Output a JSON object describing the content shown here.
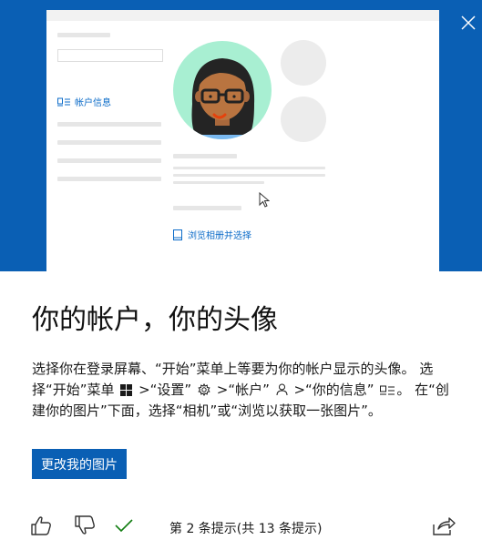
{
  "hero": {
    "side_link_label": "帐户信息",
    "browse_link_label": "浏览相册并选择",
    "accent_color": "#0a5fb4",
    "avatar_ring_color": "#a8efd2"
  },
  "tip": {
    "title": "你的帐户，你的头像",
    "desc": {
      "p1": "选择你在登录屏幕、“开始”菜单上等要为你的帐户显示的头像。 选择“开始”菜单",
      "p2": " >“设置”",
      "p3": " >“帐户”",
      "p4": " >“你的信息”",
      "p5": "。 在“创建你的图片”下面，选择“相机”或“浏览以获取一张图片”。"
    },
    "button_label": "更改我的图片"
  },
  "footer": {
    "tip_counter": "第 2 条提示(共 13 条提示)"
  },
  "icons": [
    "close-icon",
    "account-info-icon",
    "photo-icon",
    "windows-logo-icon",
    "gear-icon",
    "person-icon",
    "thumbs-up-icon",
    "thumbs-down-icon",
    "checkmark-icon",
    "share-icon"
  ]
}
